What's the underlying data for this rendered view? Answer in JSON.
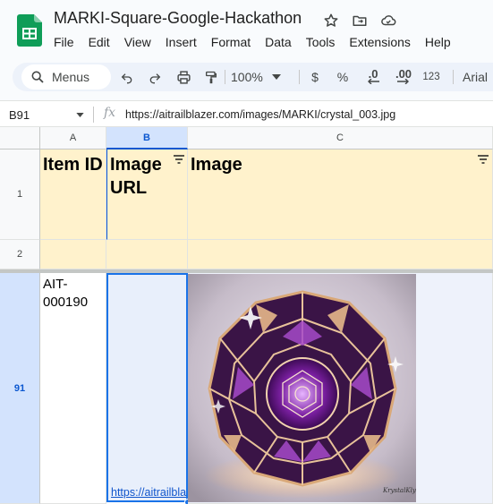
{
  "app": {
    "title": "MARKI-Square-Google-Hackathon",
    "brand_color": "#0f9d58"
  },
  "menu": [
    "File",
    "Edit",
    "View",
    "Insert",
    "Format",
    "Data",
    "Tools",
    "Extensions",
    "Help"
  ],
  "toolbar": {
    "search_label": "Menus",
    "zoom": "100%",
    "currency": "$",
    "percent": "%",
    "decrease_decimal": ".0",
    "increase_decimal": ".00",
    "number_format": "123",
    "font": "Arial"
  },
  "formula_bar": {
    "cell_ref": "B91",
    "fx": "fx",
    "formula": "https://aitrailblazer.com/images/MARKI/crystal_003.jpg"
  },
  "columns": [
    "A",
    "B",
    "C"
  ],
  "rows": {
    "header_row": "1",
    "blank_row": "2",
    "data_row": "91"
  },
  "header": {
    "item_id": "Item ID",
    "image_url": "Image URL",
    "image": "Image"
  },
  "data": {
    "item_id": "AIT-000190",
    "url_display": "https://aitrailbla",
    "image_signature": "KrystalKlyde"
  },
  "colors": {
    "header_fill": "#fff2cc",
    "selection": "#1a73e8",
    "link": "#1155cc",
    "crystal_purple": "#8e24aa",
    "crystal_gold": "#d4a373"
  },
  "icons": [
    "star-icon",
    "move-folder-icon",
    "cloud-saved-icon",
    "search-icon",
    "undo-icon",
    "redo-icon",
    "print-icon",
    "paint-format-icon",
    "filter-icon"
  ]
}
